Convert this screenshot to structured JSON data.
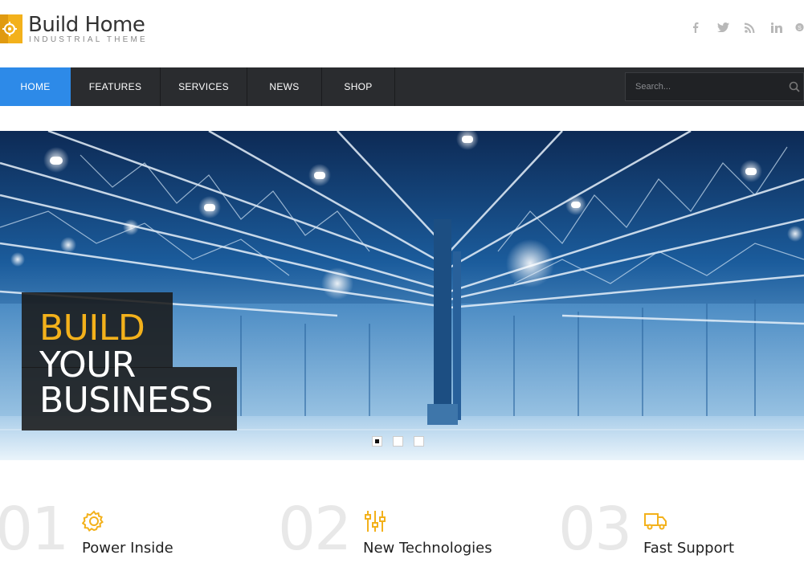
{
  "brand": {
    "title": "Build Home",
    "subtitle": "INDUSTRIAL THEME",
    "accent": "#f3b11b"
  },
  "social": [
    {
      "icon": "facebook-icon"
    },
    {
      "icon": "twitter-icon"
    },
    {
      "icon": "rss-icon"
    },
    {
      "icon": "linkedin-icon"
    },
    {
      "icon": "skype-icon"
    }
  ],
  "nav": {
    "items": [
      {
        "label": "HOME",
        "active": true
      },
      {
        "label": "FEATURES",
        "active": false
      },
      {
        "label": "SERVICES",
        "active": false
      },
      {
        "label": "NEWS",
        "active": false
      },
      {
        "label": "SHOP",
        "active": false
      }
    ],
    "active_color": "#2d8ae8",
    "search": {
      "placeholder": "Search...",
      "value": ""
    }
  },
  "hero": {
    "line1": "BUILD",
    "line2": "YOUR",
    "line3": "BUSINESS",
    "slides": 3,
    "active_slide": 1
  },
  "features": [
    {
      "number": "01",
      "title": "Power Inside",
      "icon": "gear-icon"
    },
    {
      "number": "02",
      "title": "New Technologies",
      "icon": "sliders-icon"
    },
    {
      "number": "03",
      "title": "Fast Support",
      "icon": "truck-icon"
    }
  ]
}
